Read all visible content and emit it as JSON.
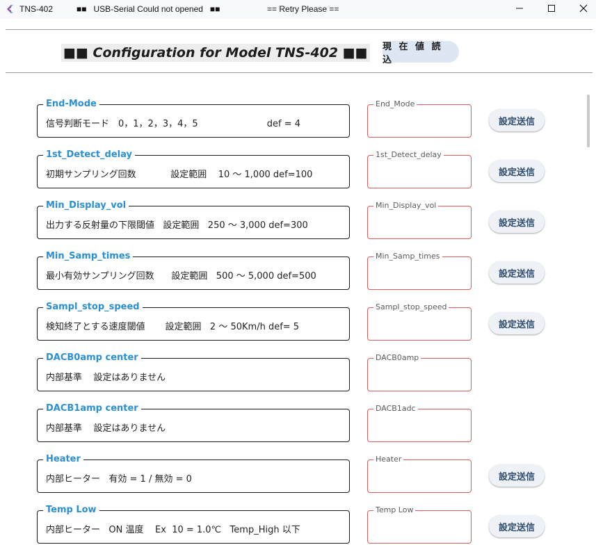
{
  "window": {
    "title": "TNS-402",
    "status_message": "■■   USB-Serial Could not opened   ■■",
    "retry_message": "== Retry Please =="
  },
  "header": {
    "title": "■■ Configuration for Model TNS-402 ■■",
    "read_button_label": "現 在 値 読 込"
  },
  "params": [
    {
      "title": "End-Mode",
      "description": "信号判断モード　0，1，2，3，4，5                        def = 4",
      "value_label": "End_Mode",
      "value": "",
      "send_label": "設定送信",
      "has_send": true
    },
    {
      "title": "1st_Detect_delay",
      "description": "初期サンプリング回数            設定範囲    10 〜 1,000 def=100",
      "value_label": "1st_Detect_delay",
      "value": "",
      "send_label": "設定送信",
      "has_send": true
    },
    {
      "title": "Min_Display_vol",
      "description": "出力する反射量の下限閾値   設定範囲   250 〜 3,000 def=300",
      "value_label": "Min_Display_vol",
      "value": "",
      "send_label": "設定送信",
      "has_send": true
    },
    {
      "title": "Min_Samp_times",
      "description": "最小有効サンプリング回数      設定範囲   500 〜 5,000 def=500",
      "value_label": "Min_Samp_times",
      "value": "",
      "send_label": "設定送信",
      "has_send": true
    },
    {
      "title": "Sampl_stop_speed",
      "description": "検知終了とする速度閾値       設定範囲   2 〜 50Km/h def= 5",
      "value_label": "Sampl_stop_speed",
      "value": "",
      "send_label": "設定送信",
      "has_send": true
    },
    {
      "title": "DACB0amp center",
      "description": "内部基準    設定はありません",
      "value_label": "DACB0amp",
      "value": "",
      "send_label": "",
      "has_send": false
    },
    {
      "title": "DACB1amp center",
      "description": "内部基準    設定はありません",
      "value_label": "DACB1adc",
      "value": "",
      "send_label": "",
      "has_send": false
    },
    {
      "title": "Heater",
      "description": "内部ヒーター   有効 = 1 / 無効 = 0",
      "value_label": "Heater",
      "value": "",
      "send_label": "設定送信",
      "has_send": true
    },
    {
      "title": "Temp Low",
      "description": "内部ヒーター   ON 温度    Ex  10 = 1.0℃   Temp_High 以下",
      "value_label": "Temp Low",
      "value": "",
      "send_label": "設定送信",
      "has_send": true
    }
  ],
  "colors": {
    "param_title": "#2a8fd4",
    "value_border": "#e05a5a",
    "app_icon": "#e8457a"
  },
  "icons": {
    "app": "app-logo-icon",
    "minimize": "minimize-icon",
    "maximize": "maximize-icon",
    "close": "close-icon"
  }
}
